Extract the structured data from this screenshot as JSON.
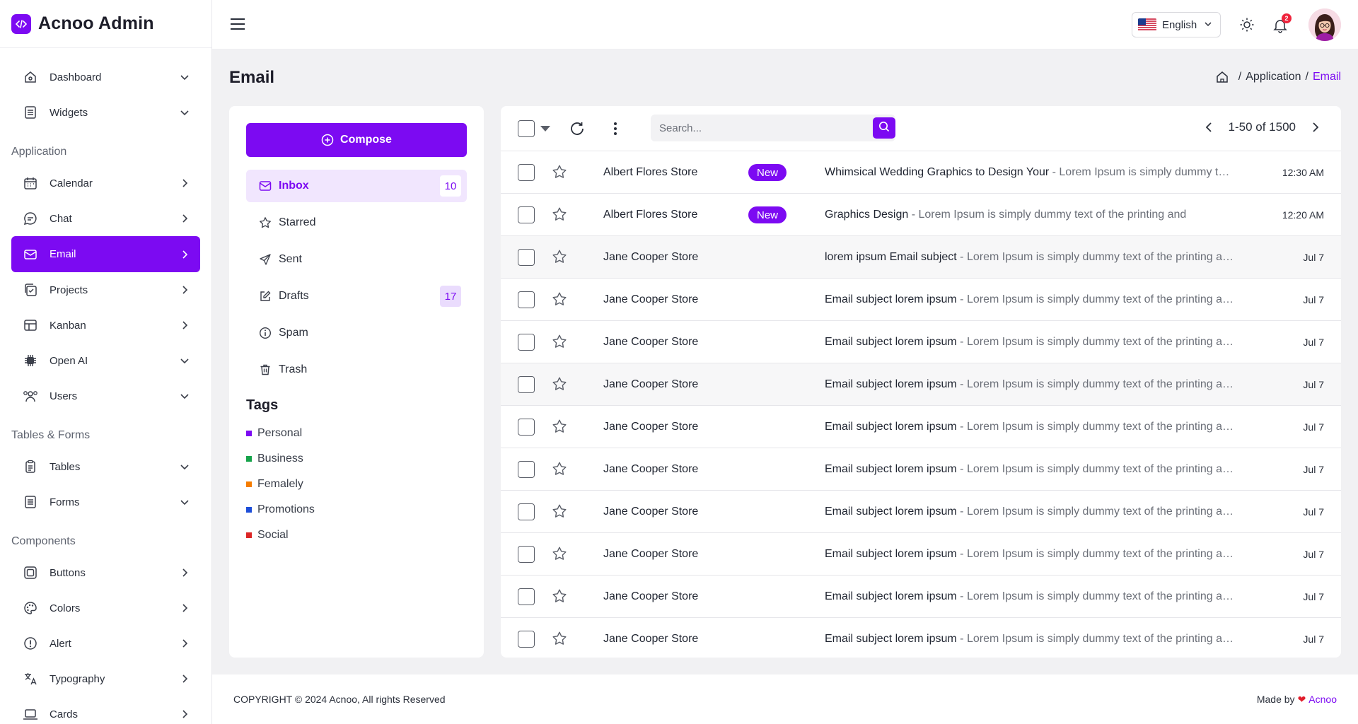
{
  "brand": {
    "name": "Acnoo Admin"
  },
  "sidebar": {
    "items_top": [
      {
        "label": "Dashboard",
        "icon": "home-icon",
        "chevron": "down"
      },
      {
        "label": "Widgets",
        "icon": "widgets-icon",
        "chevron": "down"
      }
    ],
    "sections": [
      {
        "title": "Application",
        "items": [
          {
            "label": "Calendar",
            "icon": "calendar-icon",
            "chevron": "right"
          },
          {
            "label": "Chat",
            "icon": "chat-icon",
            "chevron": "right"
          },
          {
            "label": "Email",
            "icon": "mail-icon",
            "chevron": "right",
            "active": true
          },
          {
            "label": "Projects",
            "icon": "projects-icon",
            "chevron": "right"
          },
          {
            "label": "Kanban",
            "icon": "kanban-icon",
            "chevron": "right"
          },
          {
            "label": "Open AI",
            "icon": "chip-icon",
            "chevron": "down"
          },
          {
            "label": "Users",
            "icon": "users-icon",
            "chevron": "down"
          }
        ]
      },
      {
        "title": "Tables & Forms",
        "items": [
          {
            "label": "Tables",
            "icon": "clipboard-icon",
            "chevron": "down"
          },
          {
            "label": "Forms",
            "icon": "form-icon",
            "chevron": "down"
          }
        ]
      },
      {
        "title": "Components",
        "items": [
          {
            "label": "Buttons",
            "icon": "button-icon",
            "chevron": "right"
          },
          {
            "label": "Colors",
            "icon": "palette-icon",
            "chevron": "right"
          },
          {
            "label": "Alert",
            "icon": "alert-icon",
            "chevron": "right"
          },
          {
            "label": "Typography",
            "icon": "translate-icon",
            "chevron": "right"
          },
          {
            "label": "Cards",
            "icon": "laptop-icon",
            "chevron": "right"
          }
        ]
      }
    ]
  },
  "header": {
    "language": "English",
    "notification_count": "2"
  },
  "page": {
    "title": "Email",
    "breadcrumb": {
      "sep": "/",
      "parent": "Application",
      "current": "Email"
    }
  },
  "mail_sidebar": {
    "compose_label": "Compose",
    "folders": [
      {
        "label": "Inbox",
        "icon": "inbox-icon",
        "count": "10",
        "active": true
      },
      {
        "label": "Starred",
        "icon": "star-icon",
        "count": ""
      },
      {
        "label": "Sent",
        "icon": "send-icon",
        "count": ""
      },
      {
        "label": "Drafts",
        "icon": "edit-icon",
        "count": "17"
      },
      {
        "label": "Spam",
        "icon": "info-icon",
        "count": ""
      },
      {
        "label": "Trash",
        "icon": "trash-icon",
        "count": ""
      }
    ],
    "tags_title": "Tags",
    "tags": [
      {
        "label": "Personal",
        "color": "#7c0af2"
      },
      {
        "label": "Business",
        "color": "#16a34a"
      },
      {
        "label": "Femalely",
        "color": "#f57c00"
      },
      {
        "label": "Promotions",
        "color": "#1d4ed8"
      },
      {
        "label": "Social",
        "color": "#dc2626"
      }
    ]
  },
  "mail_list": {
    "search_placeholder": "Search...",
    "pagination": "1-50 of 1500",
    "rows": [
      {
        "sender": "Albert Flores Store",
        "badge": "New",
        "subject": "Whimsical Wedding Graphics to Design Your",
        "snippet": " - Lorem Ipsum is simply dummy text of the printing and",
        "time": "12:30 AM",
        "highlight": false
      },
      {
        "sender": "Albert Flores Store",
        "badge": "New",
        "subject": "Graphics Design ",
        "snippet": " - Lorem Ipsum is simply dummy text of the printing and",
        "time": "12:20 AM",
        "highlight": false
      },
      {
        "sender": "Jane Cooper Store",
        "badge": "",
        "subject": "lorem ipsum Email subject ",
        "snippet": " - Lorem Ipsum is simply dummy text of the printing and",
        "time": "Jul 7",
        "highlight": true
      },
      {
        "sender": "Jane Cooper Store",
        "badge": "",
        "subject": "Email subject lorem ipsum",
        "snippet": " - Lorem Ipsum is simply dummy text of the printing and",
        "time": "Jul 7",
        "highlight": false
      },
      {
        "sender": "Jane Cooper Store",
        "badge": "",
        "subject": "Email subject lorem ipsum",
        "snippet": " - Lorem Ipsum is simply dummy text of the printing and",
        "time": "Jul 7",
        "highlight": false
      },
      {
        "sender": "Jane Cooper Store",
        "badge": "",
        "subject": "Email subject lorem ipsum",
        "snippet": " - Lorem Ipsum is simply dummy text of the printing and",
        "time": "Jul 7",
        "highlight": true
      },
      {
        "sender": "Jane Cooper Store",
        "badge": "",
        "subject": "Email subject lorem ipsum",
        "snippet": " - Lorem Ipsum is simply dummy text of the printing and",
        "time": "Jul 7",
        "highlight": false
      },
      {
        "sender": "Jane Cooper Store",
        "badge": "",
        "subject": "Email subject lorem ipsum",
        "snippet": " - Lorem Ipsum is simply dummy text of the printing and",
        "time": "Jul 7",
        "highlight": false
      },
      {
        "sender": "Jane Cooper Store",
        "badge": "",
        "subject": "Email subject lorem ipsum",
        "snippet": " - Lorem Ipsum is simply dummy text of the printing and",
        "time": "Jul 7",
        "highlight": false
      },
      {
        "sender": "Jane Cooper Store",
        "badge": "",
        "subject": "Email subject lorem ipsum",
        "snippet": " - Lorem Ipsum is simply dummy text of the printing and",
        "time": "Jul 7",
        "highlight": false
      },
      {
        "sender": "Jane Cooper Store",
        "badge": "",
        "subject": "Email subject lorem ipsum",
        "snippet": " - Lorem Ipsum is simply dummy text of the printing and",
        "time": "Jul 7",
        "highlight": false
      },
      {
        "sender": "Jane Cooper Store",
        "badge": "",
        "subject": "Email subject lorem ipsum",
        "snippet": " - Lorem Ipsum is simply dummy text of the printing and",
        "time": "Jul 7",
        "highlight": false
      }
    ]
  },
  "footer": {
    "copyright": "COPYRIGHT © 2024 Acnoo, All rights Reserved",
    "made_by": "Made by",
    "heart": "❤",
    "company": "Acnoo"
  },
  "colors": {
    "accent": "#7c0af2",
    "accent_soft": "#f1e6fe",
    "badge_red": "#ef233c"
  }
}
